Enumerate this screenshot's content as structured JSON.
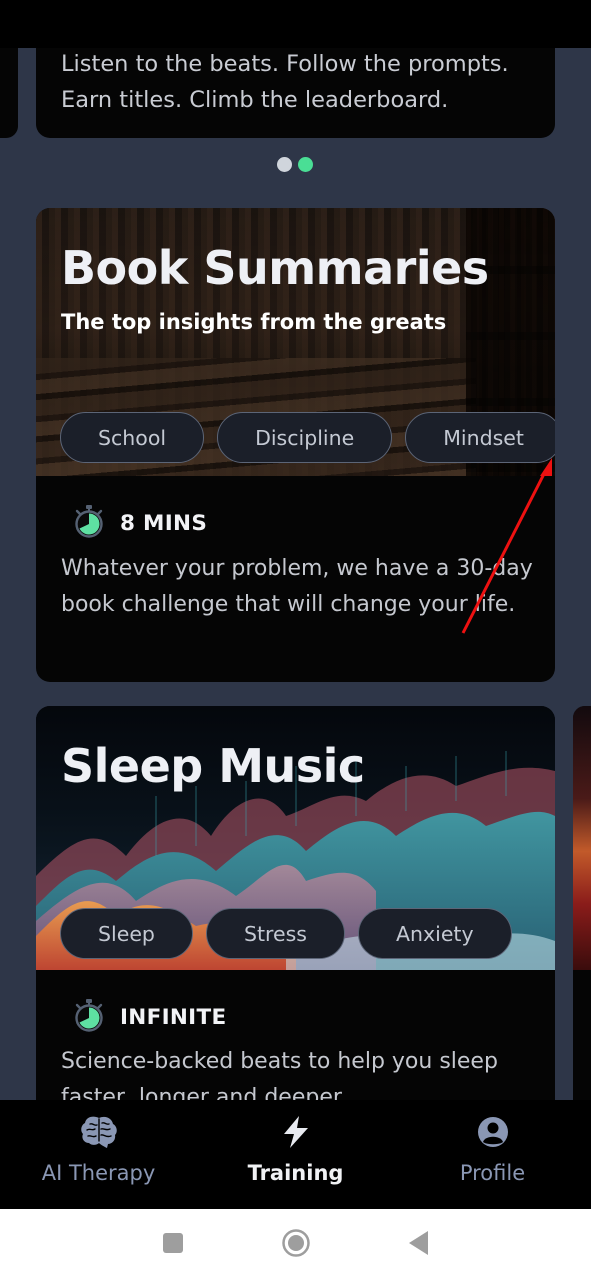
{
  "carousel": {
    "text": "Listen to the beats. Follow the prompts. Earn titles. Climb the leaderboard.",
    "pages": 2,
    "active_index": 1,
    "dot_colors": {
      "inactive": "#d0d5dc",
      "active": "#4ade95"
    }
  },
  "cards": [
    {
      "title": "Book Summaries",
      "subtitle": "The top insights from the greats",
      "tags": [
        "School",
        "Discipline",
        "Mindset"
      ],
      "duration": "8 MINS",
      "duration_icon": "stopwatch-icon",
      "description": "Whatever your problem, we have a 30-day book challenge that will change your life."
    },
    {
      "title": "Sleep Music",
      "subtitle": "",
      "tags": [
        "Sleep",
        "Stress",
        "Anxiety"
      ],
      "duration": "INFINITE",
      "duration_icon": "stopwatch-icon",
      "description": "Science-backed beats to help you sleep faster, longer and deeper."
    }
  ],
  "bottom_nav": {
    "items": [
      {
        "label": "AI Therapy",
        "icon": "brain-icon",
        "active": false
      },
      {
        "label": "Training",
        "icon": "lightning-icon",
        "active": true
      },
      {
        "label": "Profile",
        "icon": "profile-icon",
        "active": false
      }
    ]
  },
  "system_nav": {
    "buttons": [
      "recents",
      "home",
      "back"
    ]
  },
  "colors": {
    "background": "#2e3648",
    "card": "#050505",
    "accent": "#4ade95",
    "nav_inactive": "#8a97b4"
  }
}
